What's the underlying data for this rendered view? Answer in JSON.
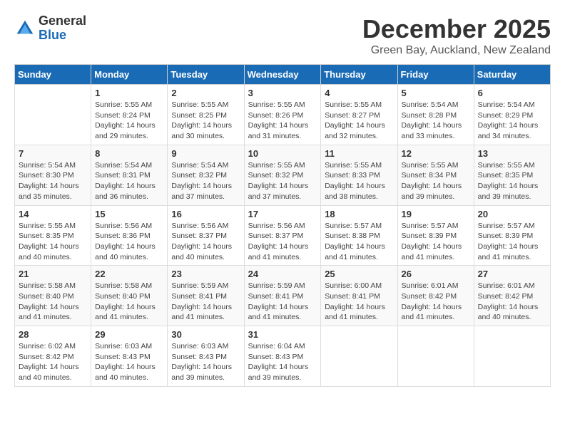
{
  "logo": {
    "general": "General",
    "blue": "Blue"
  },
  "title": "December 2025",
  "subtitle": "Green Bay, Auckland, New Zealand",
  "days_of_week": [
    "Sunday",
    "Monday",
    "Tuesday",
    "Wednesday",
    "Thursday",
    "Friday",
    "Saturday"
  ],
  "weeks": [
    [
      {
        "day": "",
        "detail": ""
      },
      {
        "day": "1",
        "detail": "Sunrise: 5:55 AM\nSunset: 8:24 PM\nDaylight: 14 hours\nand 29 minutes."
      },
      {
        "day": "2",
        "detail": "Sunrise: 5:55 AM\nSunset: 8:25 PM\nDaylight: 14 hours\nand 30 minutes."
      },
      {
        "day": "3",
        "detail": "Sunrise: 5:55 AM\nSunset: 8:26 PM\nDaylight: 14 hours\nand 31 minutes."
      },
      {
        "day": "4",
        "detail": "Sunrise: 5:55 AM\nSunset: 8:27 PM\nDaylight: 14 hours\nand 32 minutes."
      },
      {
        "day": "5",
        "detail": "Sunrise: 5:54 AM\nSunset: 8:28 PM\nDaylight: 14 hours\nand 33 minutes."
      },
      {
        "day": "6",
        "detail": "Sunrise: 5:54 AM\nSunset: 8:29 PM\nDaylight: 14 hours\nand 34 minutes."
      }
    ],
    [
      {
        "day": "7",
        "detail": "Sunrise: 5:54 AM\nSunset: 8:30 PM\nDaylight: 14 hours\nand 35 minutes."
      },
      {
        "day": "8",
        "detail": "Sunrise: 5:54 AM\nSunset: 8:31 PM\nDaylight: 14 hours\nand 36 minutes."
      },
      {
        "day": "9",
        "detail": "Sunrise: 5:54 AM\nSunset: 8:32 PM\nDaylight: 14 hours\nand 37 minutes."
      },
      {
        "day": "10",
        "detail": "Sunrise: 5:55 AM\nSunset: 8:32 PM\nDaylight: 14 hours\nand 37 minutes."
      },
      {
        "day": "11",
        "detail": "Sunrise: 5:55 AM\nSunset: 8:33 PM\nDaylight: 14 hours\nand 38 minutes."
      },
      {
        "day": "12",
        "detail": "Sunrise: 5:55 AM\nSunset: 8:34 PM\nDaylight: 14 hours\nand 39 minutes."
      },
      {
        "day": "13",
        "detail": "Sunrise: 5:55 AM\nSunset: 8:35 PM\nDaylight: 14 hours\nand 39 minutes."
      }
    ],
    [
      {
        "day": "14",
        "detail": "Sunrise: 5:55 AM\nSunset: 8:35 PM\nDaylight: 14 hours\nand 40 minutes."
      },
      {
        "day": "15",
        "detail": "Sunrise: 5:56 AM\nSunset: 8:36 PM\nDaylight: 14 hours\nand 40 minutes."
      },
      {
        "day": "16",
        "detail": "Sunrise: 5:56 AM\nSunset: 8:37 PM\nDaylight: 14 hours\nand 40 minutes."
      },
      {
        "day": "17",
        "detail": "Sunrise: 5:56 AM\nSunset: 8:37 PM\nDaylight: 14 hours\nand 41 minutes."
      },
      {
        "day": "18",
        "detail": "Sunrise: 5:57 AM\nSunset: 8:38 PM\nDaylight: 14 hours\nand 41 minutes."
      },
      {
        "day": "19",
        "detail": "Sunrise: 5:57 AM\nSunset: 8:39 PM\nDaylight: 14 hours\nand 41 minutes."
      },
      {
        "day": "20",
        "detail": "Sunrise: 5:57 AM\nSunset: 8:39 PM\nDaylight: 14 hours\nand 41 minutes."
      }
    ],
    [
      {
        "day": "21",
        "detail": "Sunrise: 5:58 AM\nSunset: 8:40 PM\nDaylight: 14 hours\nand 41 minutes."
      },
      {
        "day": "22",
        "detail": "Sunrise: 5:58 AM\nSunset: 8:40 PM\nDaylight: 14 hours\nand 41 minutes."
      },
      {
        "day": "23",
        "detail": "Sunrise: 5:59 AM\nSunset: 8:41 PM\nDaylight: 14 hours\nand 41 minutes."
      },
      {
        "day": "24",
        "detail": "Sunrise: 5:59 AM\nSunset: 8:41 PM\nDaylight: 14 hours\nand 41 minutes."
      },
      {
        "day": "25",
        "detail": "Sunrise: 6:00 AM\nSunset: 8:41 PM\nDaylight: 14 hours\nand 41 minutes."
      },
      {
        "day": "26",
        "detail": "Sunrise: 6:01 AM\nSunset: 8:42 PM\nDaylight: 14 hours\nand 41 minutes."
      },
      {
        "day": "27",
        "detail": "Sunrise: 6:01 AM\nSunset: 8:42 PM\nDaylight: 14 hours\nand 40 minutes."
      }
    ],
    [
      {
        "day": "28",
        "detail": "Sunrise: 6:02 AM\nSunset: 8:42 PM\nDaylight: 14 hours\nand 40 minutes."
      },
      {
        "day": "29",
        "detail": "Sunrise: 6:03 AM\nSunset: 8:43 PM\nDaylight: 14 hours\nand 40 minutes."
      },
      {
        "day": "30",
        "detail": "Sunrise: 6:03 AM\nSunset: 8:43 PM\nDaylight: 14 hours\nand 39 minutes."
      },
      {
        "day": "31",
        "detail": "Sunrise: 6:04 AM\nSunset: 8:43 PM\nDaylight: 14 hours\nand 39 minutes."
      },
      {
        "day": "",
        "detail": ""
      },
      {
        "day": "",
        "detail": ""
      },
      {
        "day": "",
        "detail": ""
      }
    ]
  ]
}
